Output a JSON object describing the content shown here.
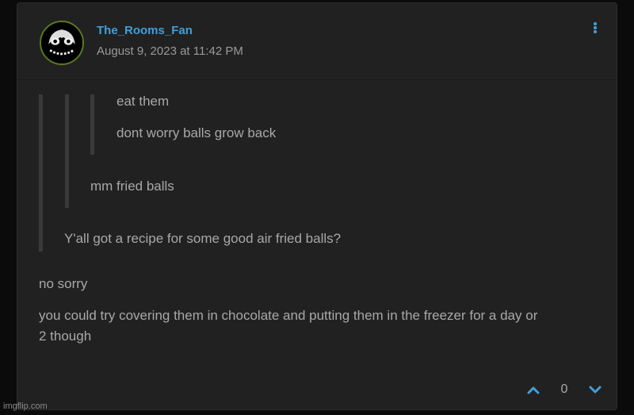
{
  "post": {
    "author": "The_Rooms_Fan",
    "timestamp": "August 9, 2023 at 11:42 PM",
    "quotes": {
      "level3": [
        "eat them",
        "dont worry balls grow back"
      ],
      "level2": "mm fried balls",
      "level1": "Y'all got a recipe for some good air fried balls?"
    },
    "reply": [
      "no sorry",
      "you could try covering them in chocolate and putting them in the freezer for a day or",
      "2 though"
    ],
    "votes": 0
  },
  "icons": {
    "options": "vertical-ellipsis-icon",
    "upvote": "chevron-up-icon",
    "downvote": "chevron-down-icon"
  },
  "colors": {
    "accent": "#3fa0d8",
    "card": "#212121",
    "text": "#a8a8a8",
    "avatar_ring": "#5c7a1c"
  },
  "watermark": "imgflip.com"
}
